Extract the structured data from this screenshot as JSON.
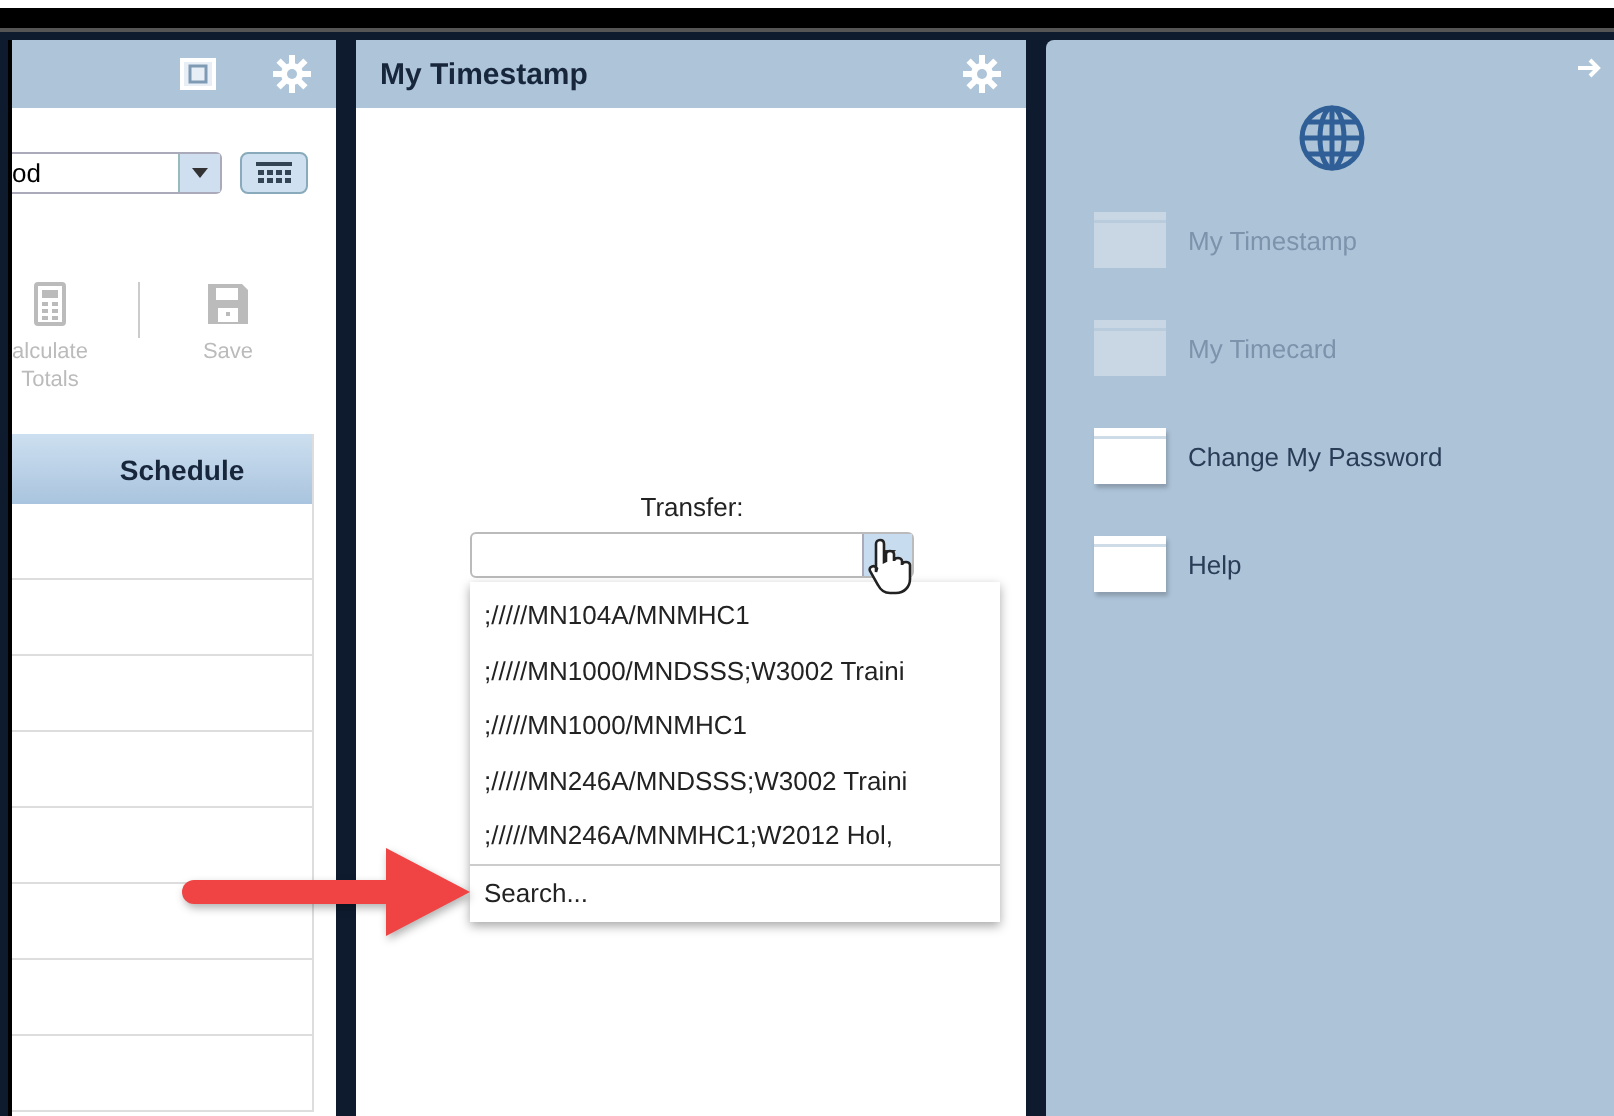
{
  "left_panel": {
    "period_select": {
      "value": "od"
    },
    "toolbar": [
      {
        "label": "alculate\nTotals",
        "kind": "calculator",
        "disabled": true
      },
      {
        "label": "Save",
        "kind": "save",
        "disabled": true
      }
    ],
    "table": {
      "columns": [
        "Schedule"
      ]
    }
  },
  "timestamp_panel": {
    "title": "My Timestamp",
    "transfer": {
      "label": "Transfer:",
      "expanded": true,
      "options": [
        {
          "label": ";/////MN104A/MNMHC1"
        },
        {
          "label": ";/////MN1000/MNDSSS;W3002 Traini"
        },
        {
          "label": ";/////MN1000/MNMHC1"
        },
        {
          "label": ";/////MN246A/MNDSSS;W3002 Traini"
        },
        {
          "label": ";/////MN246A/MNMHC1;W2012 Hol,"
        }
      ],
      "search_option": "Search..."
    }
  },
  "side_menu": {
    "items": [
      {
        "label": "My Timestamp",
        "disabled": true
      },
      {
        "label": "My Timecard",
        "disabled": true
      },
      {
        "label": "Change My Password",
        "disabled": false
      },
      {
        "label": "Help",
        "disabled": false
      }
    ]
  }
}
